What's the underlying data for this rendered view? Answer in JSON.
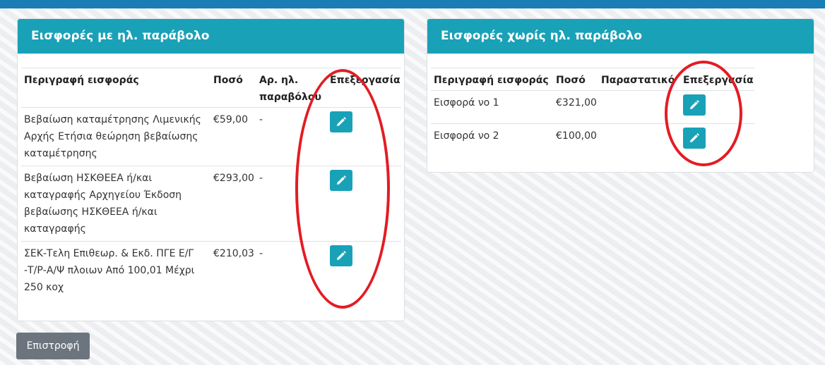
{
  "left_panel": {
    "title": "Εισφορές με ηλ. παράβολο",
    "columns": [
      "Περιγραφή εισφοράς",
      "Ποσό",
      "Αρ. ηλ. παραβόλου",
      "Επεξεργασία"
    ],
    "rows": [
      {
        "description": "Βεβαίωση καταμέτρησης Λιμενικής Αρχής Ετήσια θεώρηση βεβαίωσης καταμέτρησης",
        "amount": "€59,00",
        "receipt_no": "-"
      },
      {
        "description": "Βεβαίωση ΗΣΚΘΕΕΑ ή/και καταγραφής Αρχηγείου Έκδοση βεβαίωσης ΗΣΚΘΕΕΑ ή/και καταγραφής",
        "amount": "€293,00",
        "receipt_no": "-"
      },
      {
        "description": "ΣΕΚ-Τελη Επιθεωρ. & Εκδ. ΠΓΕ Ε/Γ -Τ/Ρ-Α/Ψ πλοιων Από 100,01 Μέχρι 250 κοχ",
        "amount": "€210,03",
        "receipt_no": "-"
      }
    ]
  },
  "right_panel": {
    "title": "Εισφορές χωρίς ηλ. παράβολο",
    "columns": [
      "Περιγραφή εισφοράς",
      "Ποσό",
      "Παραστατικό",
      "Επεξεργασία"
    ],
    "rows": [
      {
        "description": "Εισφορά νο 1",
        "amount": "€321,00",
        "document": ""
      },
      {
        "description": "Εισφορά νο 2",
        "amount": "€100,00",
        "document": ""
      }
    ]
  },
  "back_button": {
    "label": "Επιστροφή"
  },
  "icons": {
    "edit": "pencil-icon"
  },
  "colors": {
    "header": "#19a1b7",
    "topbar": "#1a7db5",
    "annotation": "#e31c23",
    "back_button": "#6c757d"
  }
}
